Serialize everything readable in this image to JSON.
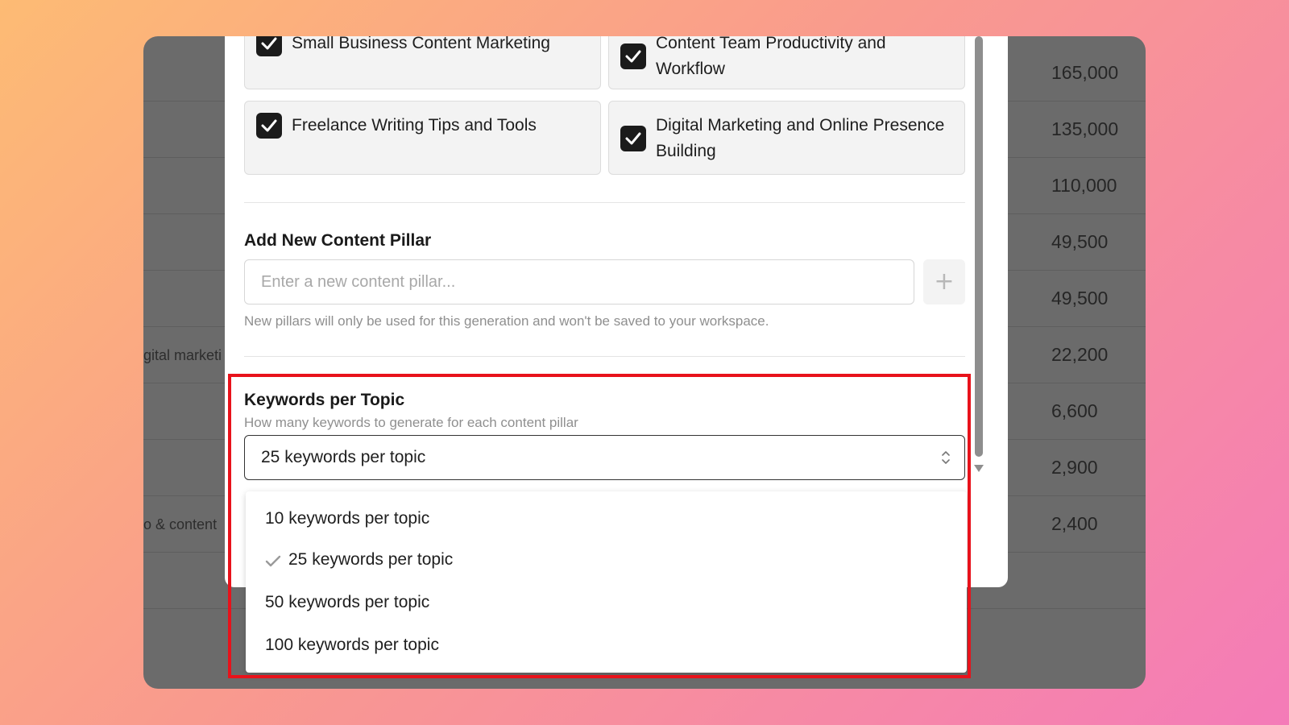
{
  "background_table": {
    "values": [
      "165,000",
      "135,000",
      "110,000",
      "49,500",
      "49,500",
      "22,200",
      "6,600",
      "2,900",
      "2,400"
    ],
    "row_snippets": [
      "",
      "",
      "",
      "",
      "",
      "gital marketi",
      "",
      "",
      "o & content"
    ]
  },
  "pillars": [
    {
      "label": "Small Business Content Marketing",
      "checked": true
    },
    {
      "label": "Content Team Productivity and Workflow",
      "checked": true
    },
    {
      "label": "Freelance Writing Tips and Tools",
      "checked": true
    },
    {
      "label": "Digital Marketing and Online Presence Building",
      "checked": true
    }
  ],
  "add_pillar": {
    "title": "Add New Content Pillar",
    "placeholder": "Enter a new content pillar...",
    "add_icon": "plus-icon",
    "add_symbol": "+",
    "helper": "New pillars will only be used for this generation and won't be saved to your workspace."
  },
  "keywords": {
    "title": "Keywords per Topic",
    "description": "How many keywords to generate for each content pillar",
    "selected": "25 keywords per topic",
    "options": [
      {
        "label": "10 keywords per topic",
        "selected": false
      },
      {
        "label": "25 keywords per topic",
        "selected": true
      },
      {
        "label": "50 keywords per topic",
        "selected": false
      },
      {
        "label": "100 keywords per topic",
        "selected": false
      }
    ]
  },
  "colors": {
    "highlight": "#e8121b",
    "checkbox": "#1b1b1b",
    "overlay": "#6b6b6b"
  }
}
